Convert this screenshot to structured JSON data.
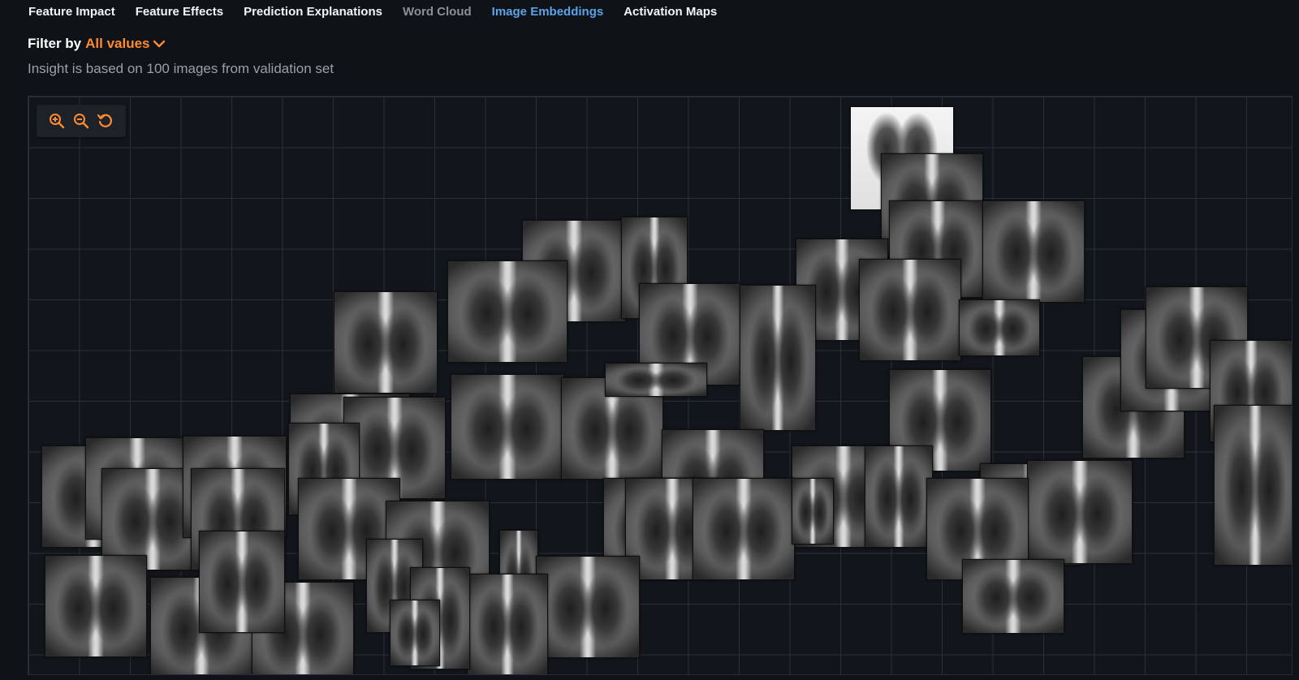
{
  "tabs": [
    {
      "label": "Feature Impact",
      "state": "normal"
    },
    {
      "label": "Feature Effects",
      "state": "normal"
    },
    {
      "label": "Prediction Explanations",
      "state": "normal"
    },
    {
      "label": "Word Cloud",
      "state": "disabled"
    },
    {
      "label": "Image Embeddings",
      "state": "active"
    },
    {
      "label": "Activation Maps",
      "state": "normal"
    }
  ],
  "filter": {
    "label": "Filter by",
    "value": "All values"
  },
  "subtitle": "Insight is based on 100 images from validation set",
  "toolbar": {
    "zoom_in_icon": "zoom-in-icon",
    "zoom_out_icon": "zoom-out-icon",
    "reset_icon": "reset-icon"
  },
  "colors": {
    "background": "#0f1217",
    "accent_orange": "#ff8a2f",
    "active_tab": "#5ba3e8",
    "grid_line": "#2a3038"
  }
}
